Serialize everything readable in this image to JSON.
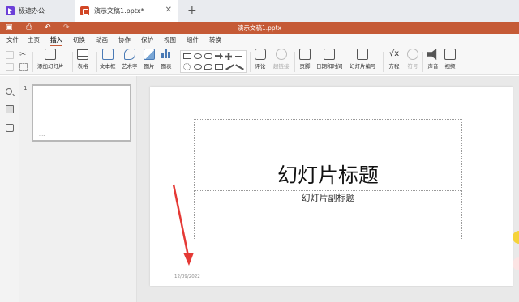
{
  "tabs": {
    "home_label": "极速办公",
    "doc_label": "演示文稿1.pptx*",
    "close_glyph": "✕",
    "add_glyph": "+"
  },
  "titlebar": {
    "title": "演示文稿1.pptx",
    "color": "#c55a36"
  },
  "menu": {
    "items": [
      "文件",
      "主页",
      "插入",
      "切换",
      "动画",
      "协作",
      "保护",
      "视图",
      "组件",
      "转换"
    ],
    "active": "插入"
  },
  "ribbon": {
    "add_slide": "添加幻灯片",
    "table": "表格",
    "textbox": "文本框",
    "wordart": "艺术字",
    "image": "图片",
    "chart": "图表",
    "comment": "评论",
    "hyperlink": "超链接",
    "header_footer": "页脚",
    "datetime": "日期和时间",
    "slide_number": "幻灯片编号",
    "equation": "方程",
    "symbol": "符号",
    "audio": "声音",
    "video": "视频"
  },
  "thumbnails": [
    {
      "number": "1",
      "footer": "...."
    }
  ],
  "slide": {
    "title": "幻灯片标题",
    "subtitle": "幻灯片副标题",
    "date": "12/09/2022"
  },
  "annotation": {
    "arrow_color": "#e53935"
  }
}
